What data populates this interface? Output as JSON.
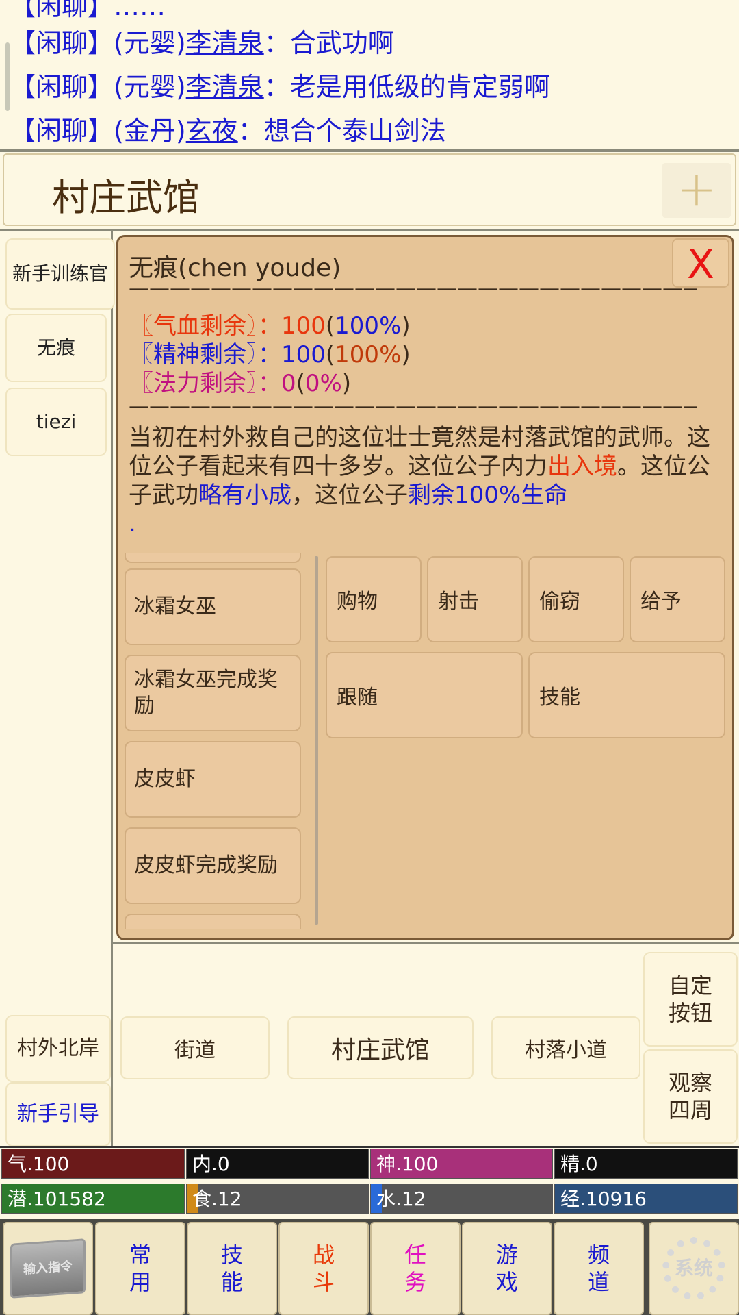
{
  "chat": {
    "messages": [
      {
        "channel": "【闲聊】",
        "rank": "(元婴)",
        "name": "李清泉",
        "text": "：合武功啊"
      },
      {
        "channel": "【闲聊】",
        "rank": "(元婴)",
        "name": "李清泉",
        "text": "：老是用低级的肯定弱啊"
      },
      {
        "channel": "【闲聊】",
        "rank": "(金丹)",
        "name": "玄夜",
        "text": "：想合个泰山剑法"
      }
    ]
  },
  "location": {
    "title": "村庄武馆",
    "add_icon": "plus-icon"
  },
  "npcs": [
    "新手训练官",
    "无痕",
    "tiezi"
  ],
  "dialog": {
    "name": "无痕(chen youde)",
    "close_label": "X",
    "divider": "————————————————————————————————",
    "stats": [
      {
        "label": "〖气血剩余〗：",
        "value": "100",
        "pct": "100%"
      },
      {
        "label": "〖精神剩余〗：",
        "value": "100",
        "pct": "100%"
      },
      {
        "label": "〖法力剩余〗：",
        "value": "0",
        "pct": "0%"
      }
    ],
    "desc": {
      "p1": "当初在村外救自己的这位壮士竟然是村落武馆的武师。这位公子看起来有四十多岁。这位公子内力",
      "h1": "出入境",
      "p2": "。这位公子武功",
      "h2": "略有小成",
      "p3": "，这位公子",
      "h3": "剩余100%生命",
      "p4": "."
    },
    "quests": [
      "冰霜女巫",
      "冰霜女巫完成奖励",
      "皮皮虾",
      "皮皮虾完成奖励"
    ],
    "actions": [
      "购物",
      "射击",
      "偷窃",
      "给予",
      "跟随",
      "技能"
    ]
  },
  "exits": {
    "left_top": "村外北岸",
    "left_bottom": "新手引导",
    "west": "街道",
    "current": "村庄武馆",
    "east": "村落小道"
  },
  "side_buttons": [
    "自定\n按钮",
    "观察\n四周"
  ],
  "status": [
    {
      "label": "气.100",
      "color": "#6b1a1a",
      "fill": 1.0
    },
    {
      "label": "内.0",
      "color": "#111111",
      "fill": 0.0
    },
    {
      "label": "神.100",
      "color": "#a8307a",
      "fill": 1.0
    },
    {
      "label": "精.0",
      "color": "#111111",
      "fill": 0.0
    },
    {
      "label": "潜.101582",
      "color": "#2c7a2c",
      "fill": 1.0
    },
    {
      "label": "食.12",
      "color": "#d08a18",
      "fill": 0.06
    },
    {
      "label": "水.12",
      "color": "#2a6ad8",
      "fill": 0.06
    },
    {
      "label": "经.10916",
      "color": "#2b4f7a",
      "fill": 1.0
    }
  ],
  "tabs": [
    {
      "label": "常\n用",
      "color": "#1a1ad0"
    },
    {
      "label": "技\n能",
      "color": "#1a1ad0"
    },
    {
      "label": "战\n斗",
      "color": "#e83a0a"
    },
    {
      "label": "任\n务",
      "color": "#e010c0"
    },
    {
      "label": "游\n戏",
      "color": "#1a1ad0"
    },
    {
      "label": "频\n道",
      "color": "#1a1ad0"
    }
  ],
  "tab_icons": {
    "input": "输入指令",
    "system": "系统"
  }
}
